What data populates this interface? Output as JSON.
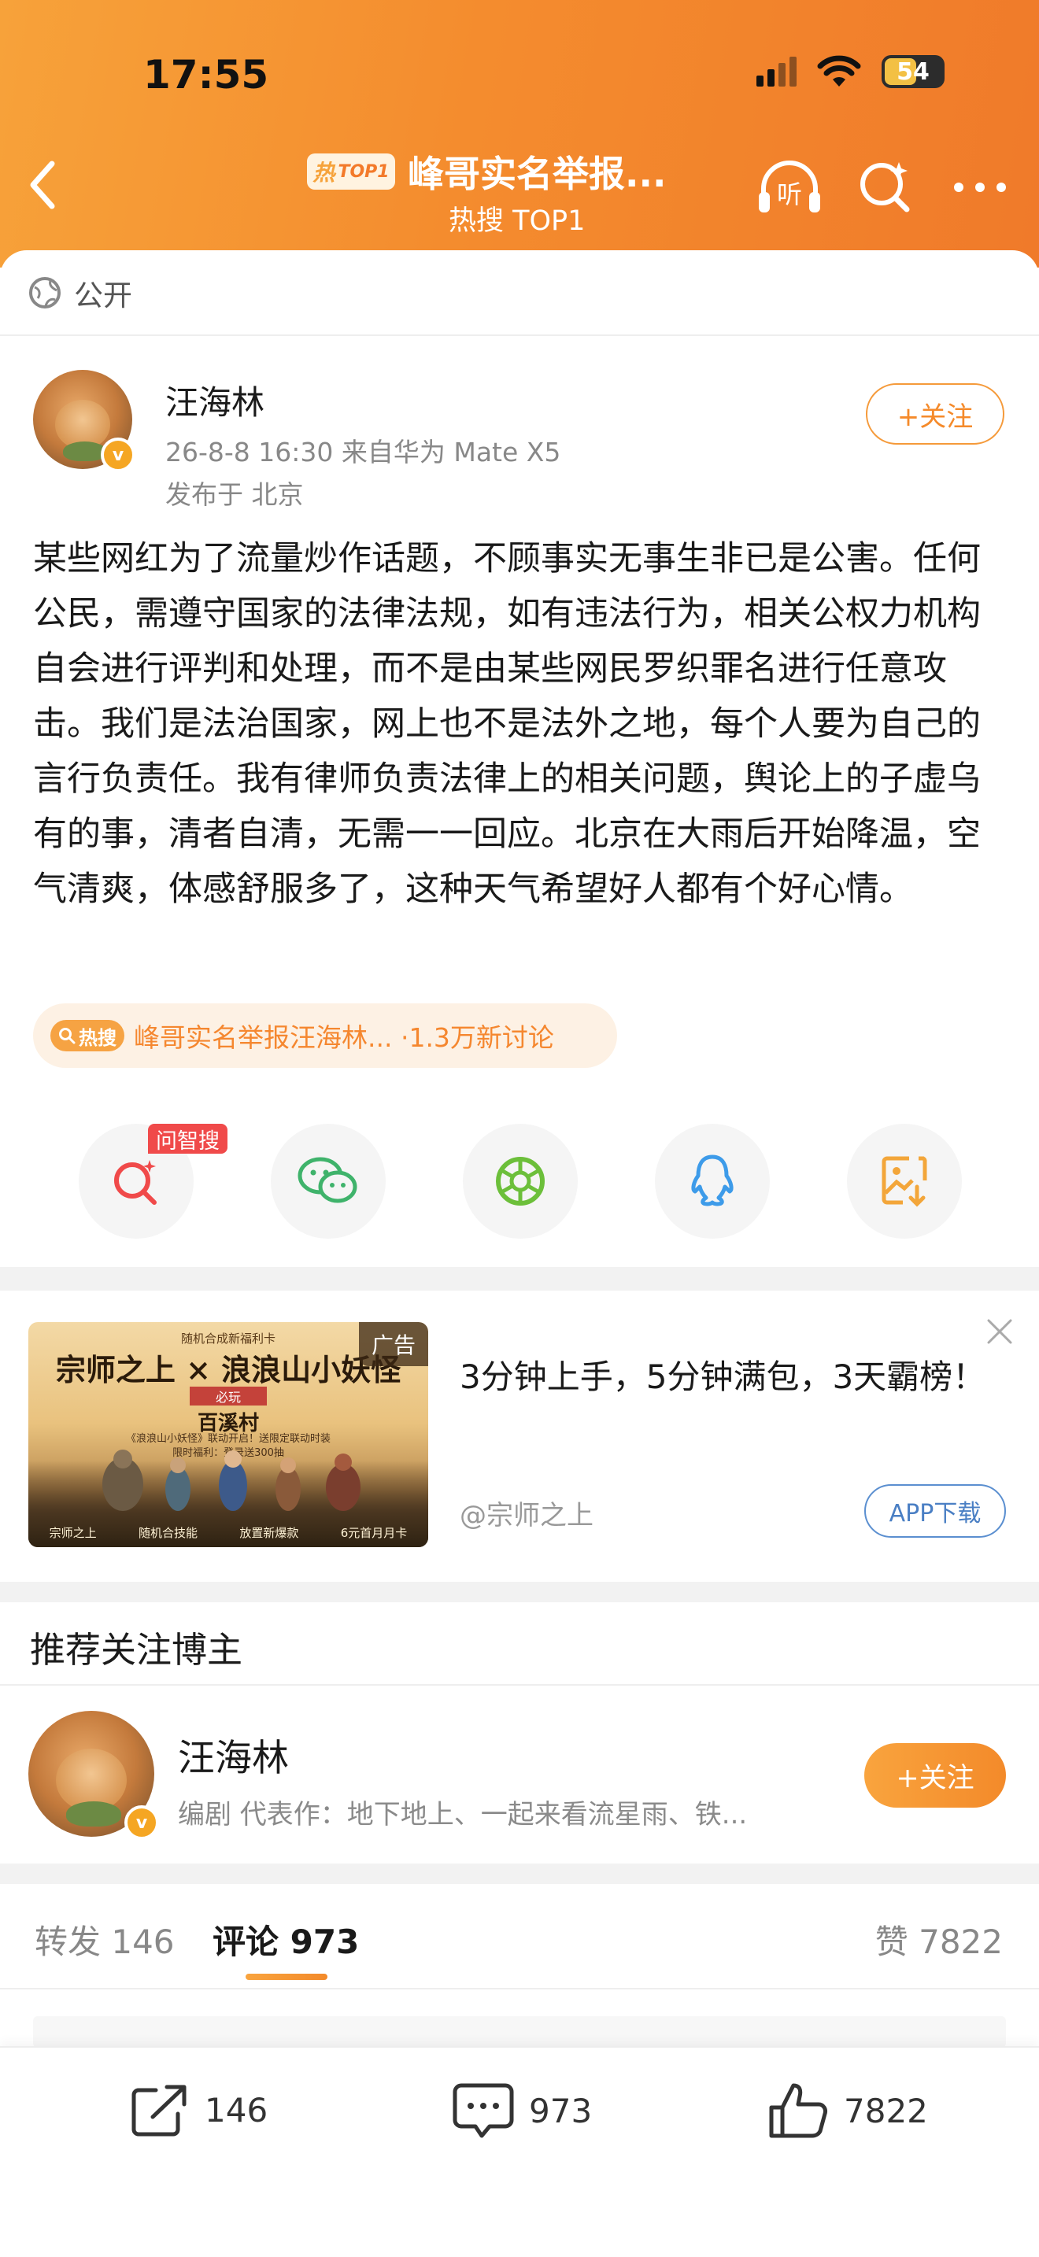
{
  "status_bar": {
    "time": "17:55",
    "battery": "54"
  },
  "header": {
    "hot_badge": "TOP1",
    "hot_badge_char": "热",
    "title": "峰哥实名举报...",
    "subtitle": "热搜 TOP1",
    "listen_label": "听"
  },
  "visibility": "公开",
  "post": {
    "author": "汪海林",
    "meta": "26-8-8 16:30  来自华为 Mate X5",
    "location": "发布于 北京",
    "follow_label": "+关注",
    "verified_badge": "v",
    "body": "某些网红为了流量炒作话题，不顾事实无事生非已是公害。任何公民，需遵守国家的法律法规，如有违法行为，相关公权力机构自会进行评判和处理，而不是由某些网民罗织罪名进行任意攻击。我们是法治国家，网上也不是法外之地，每个人要为自己的言行负责任。我有律师负责法律上的相关问题，舆论上的子虚乌有的事，清者自清，无需一一回应。北京在大雨后开始降温，空气清爽，体感舒服多了，这种天气希望好人都有个好心情。",
    "topic_badge": "热搜",
    "topic_text": "峰哥实名举报汪海林... ·1.3万新讨论"
  },
  "share": {
    "ask_badge": "问智搜"
  },
  "ad": {
    "tag": "广告",
    "image_top_text": "随机合成新福利卡",
    "image_logo": "宗师之上 × 浪浪山小妖怪",
    "image_ribbon": "必玩",
    "image_village": "百溪村",
    "image_small_1": "《浪浪山小妖怪》联动开启！送限定联动时装",
    "image_small_2": "限时福利：登录送300抽",
    "image_bottom": [
      "宗师之上",
      "随机合技能",
      "放置新爆款",
      "6元首月月卡"
    ],
    "headline": "3分钟上手，5分钟满包，3天霸榜！",
    "source": "@宗师之上",
    "download_label": "APP下载"
  },
  "recommend": {
    "title": "推荐关注博主",
    "name": "汪海林",
    "desc": "编剧  代表作：地下地上、一起来看流星雨、铁...",
    "follow_label": "+关注"
  },
  "tabs": {
    "repost": "转发 146",
    "comment": "评论 973",
    "like": "赞 7822"
  },
  "bottom_bar": {
    "repost": "146",
    "comment": "973",
    "like": "7822"
  },
  "colors": {
    "accent": "#f38a2a",
    "header_start": "#f7a23a",
    "header_end": "#f07a2a",
    "link_blue": "#4a7fc4"
  }
}
